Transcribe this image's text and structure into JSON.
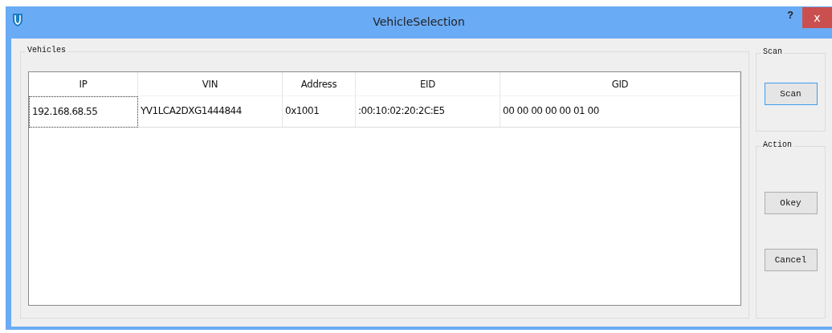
{
  "window": {
    "title": "VehicleSelection",
    "help": "?",
    "close": "x"
  },
  "vehicles": {
    "title": "Vehicles",
    "columns": [
      "IP",
      "VIN",
      "Address",
      "EID",
      "GID"
    ],
    "rows": [
      {
        "cells": [
          {
            "text": "192.168.68.55",
            "selected": true
          },
          {
            "text": "YV1LCA2DXG1444844",
            "selected": false
          },
          {
            "text": "0x1001",
            "selected": false
          },
          {
            "text": ":00:10:02:20:2C:E5",
            "selected": false
          },
          {
            "text": "00 00 00 00 00 01 00",
            "selected": false
          }
        ]
      }
    ]
  },
  "scan": {
    "title": "Scan",
    "buttons": [
      {
        "label": "Scan",
        "default": true
      }
    ]
  },
  "action": {
    "title": "Action",
    "buttons": [
      {
        "label": "Okey",
        "default": false
      },
      {
        "label": "Cancel",
        "default": false
      }
    ]
  }
}
